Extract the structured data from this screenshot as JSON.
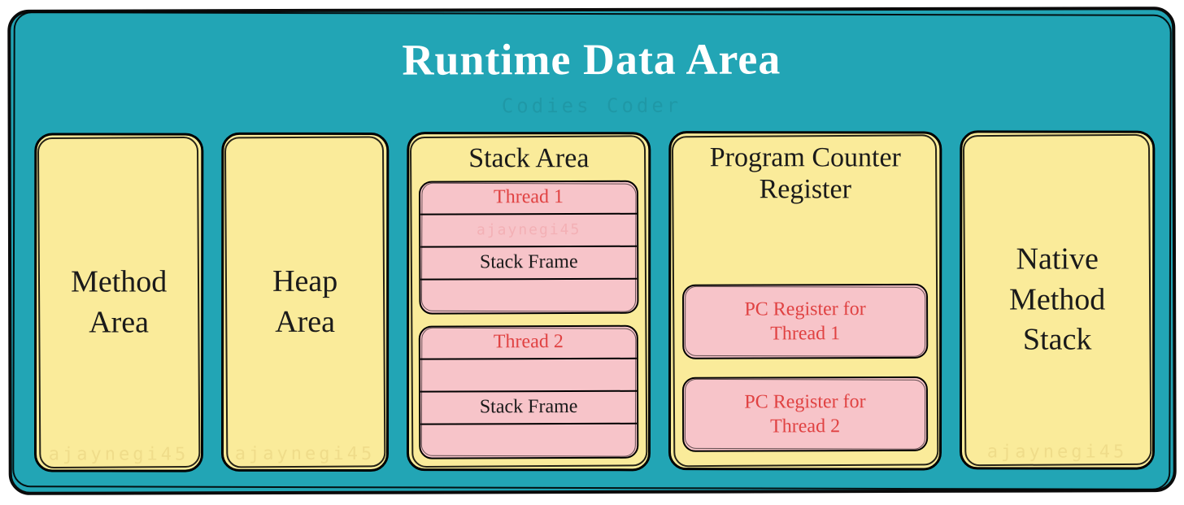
{
  "diagram": {
    "title": "Runtime Data Area",
    "watermark_author": "ajaynegi45",
    "watermark_brand": "Codies Coder",
    "areas": {
      "method": {
        "label": "Method\nArea"
      },
      "heap": {
        "label": "Heap\nArea"
      },
      "stack": {
        "label": "Stack Area",
        "threads": [
          {
            "title": "Thread 1",
            "middle_watermark": "ajaynegi45",
            "frame_label": "Stack Frame"
          },
          {
            "title": "Thread 2",
            "middle_watermark": "",
            "frame_label": "Stack Frame"
          }
        ]
      },
      "pc": {
        "label": "Program Counter\nRegister",
        "registers": [
          "PC Register for\nThread 1",
          "PC Register for\nThread 2"
        ]
      },
      "native": {
        "label": "Native\nMethod\nStack"
      }
    }
  }
}
